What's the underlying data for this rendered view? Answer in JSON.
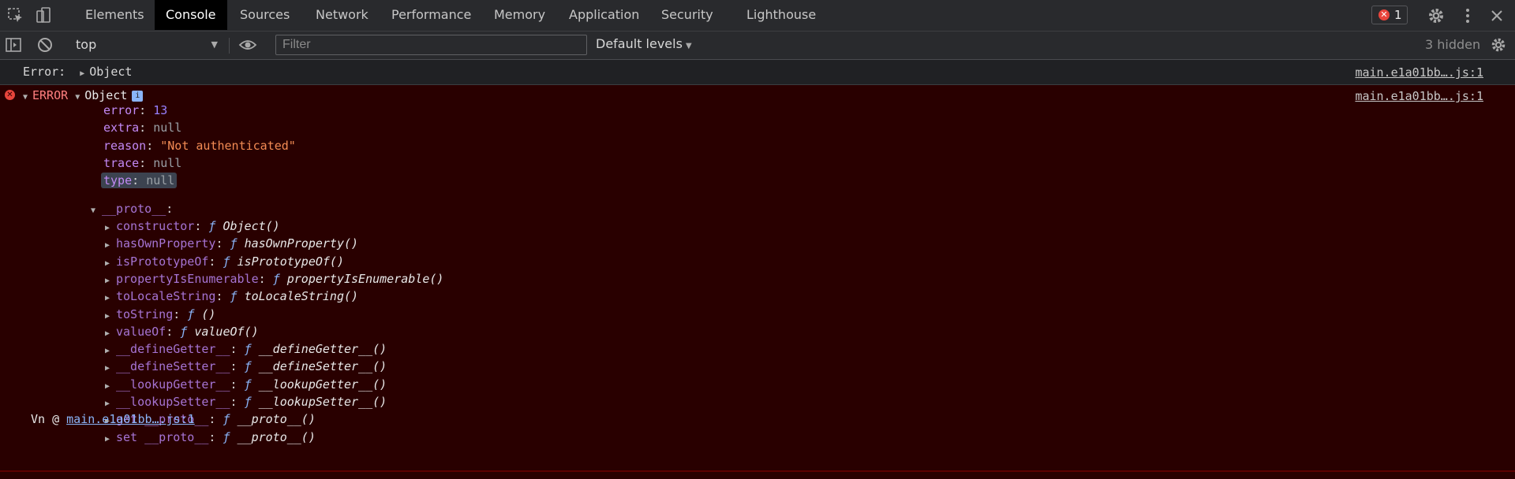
{
  "tabs": [
    {
      "label": "Elements"
    },
    {
      "label": "Console"
    },
    {
      "label": "Sources"
    },
    {
      "label": "Network"
    },
    {
      "label": "Performance"
    },
    {
      "label": "Memory"
    },
    {
      "label": "Application"
    },
    {
      "label": "Security"
    },
    {
      "label": "Lighthouse"
    }
  ],
  "active_tab": "Console",
  "error_count": "1",
  "toolbar": {
    "context": "top",
    "filter_placeholder": "Filter",
    "levels": "Default levels",
    "hidden": "3 hidden"
  },
  "messages": {
    "plain": {
      "label": "Error:",
      "object": "Object",
      "source": "main.e1a01bb….js:1"
    },
    "error": {
      "label": "ERROR",
      "object": "Object",
      "source": "main.e1a01bb….js:1",
      "properties": [
        {
          "key": "error",
          "value": "13"
        },
        {
          "key": "extra",
          "value": "null"
        },
        {
          "key": "reason",
          "value": "\"Not authenticated\""
        },
        {
          "key": "trace",
          "value": "null"
        },
        {
          "key": "type",
          "value": "null"
        }
      ],
      "proto_label": "__proto__",
      "proto_items": [
        {
          "key": "constructor",
          "fn": "Object()"
        },
        {
          "key": "hasOwnProperty",
          "fn": "hasOwnProperty()"
        },
        {
          "key": "isPrototypeOf",
          "fn": "isPrototypeOf()"
        },
        {
          "key": "propertyIsEnumerable",
          "fn": "propertyIsEnumerable()"
        },
        {
          "key": "toLocaleString",
          "fn": "toLocaleString()"
        },
        {
          "key": "toString",
          "fn": "()"
        },
        {
          "key": "valueOf",
          "fn": "valueOf()"
        },
        {
          "key": "__defineGetter__",
          "fn": "__defineGetter__()"
        },
        {
          "key": "__defineSetter__",
          "fn": "__defineSetter__()"
        },
        {
          "key": "__lookupGetter__",
          "fn": "__lookupGetter__()"
        },
        {
          "key": "__lookupSetter__",
          "fn": "__lookupSetter__()"
        },
        {
          "key": "get __proto__",
          "fn": "__proto__()"
        },
        {
          "key": "set __proto__",
          "fn": "__proto__()"
        }
      ],
      "fn_keyword": "ƒ",
      "stack_fn": "Vn @",
      "stack_link": "main.e1a01bb….js:1"
    }
  },
  "colors": {
    "error_bg": "#290000",
    "toolbar_bg": "#292a2d",
    "active_tab_bg": "#000000",
    "key_purple": "#c289f5",
    "string_orange": "#f28b54",
    "number_blue": "#9980ff"
  },
  "icons": [
    "inspect-element-icon",
    "device-toggle-icon",
    "sidebar-toggle-icon",
    "clear-console-icon",
    "eye-icon",
    "gear-icon",
    "more-vert-icon",
    "close-icon",
    "error-circle-icon",
    "info-icon"
  ]
}
